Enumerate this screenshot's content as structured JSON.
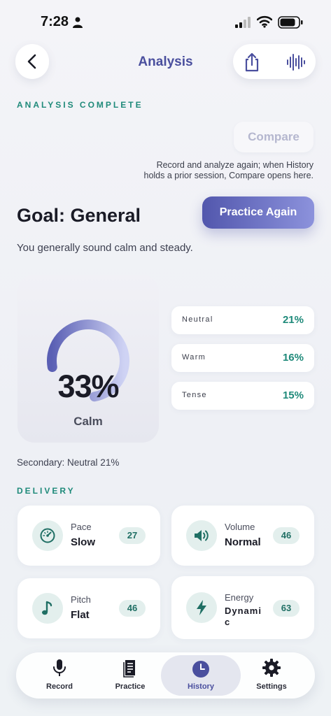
{
  "status": {
    "time": "7:28"
  },
  "header": {
    "title": "Analysis"
  },
  "analysis": {
    "status_label": "ANALYSIS COMPLETE",
    "compare_label": "Compare",
    "compare_hint": "Record and analyze again; when History holds a prior session, Compare opens here.",
    "goal_title": "Goal: General",
    "practice_label": "Practice Again",
    "summary": "You generally sound calm and steady."
  },
  "emotion": {
    "primary_percent": "33%",
    "primary_fraction": 0.33,
    "primary_label": "Calm",
    "others": [
      {
        "name": "Neutral",
        "value": "21%"
      },
      {
        "name": "Warm",
        "value": "16%"
      },
      {
        "name": "Tense",
        "value": "15%"
      }
    ],
    "secondary": "Secondary: Neutral 21%"
  },
  "delivery": {
    "section_label": "DELIVERY",
    "metrics": [
      {
        "name": "Pace",
        "value": "Slow",
        "score": "27",
        "icon": "speedometer-icon"
      },
      {
        "name": "Volume",
        "value": "Normal",
        "score": "46",
        "icon": "speaker-icon"
      },
      {
        "name": "Pitch",
        "value": "Flat",
        "score": "46",
        "icon": "music-note-icon"
      },
      {
        "name": "Energy",
        "value": "Dynamic",
        "score": "63",
        "icon": "lightning-icon"
      }
    ]
  },
  "tabs": [
    {
      "label": "Record",
      "icon": "microphone-icon"
    },
    {
      "label": "Practice",
      "icon": "document-icon"
    },
    {
      "label": "History",
      "icon": "clock-icon"
    },
    {
      "label": "Settings",
      "icon": "gear-icon"
    }
  ],
  "colors": {
    "accent": "#4a4f9e",
    "teal": "#1f8a7a",
    "gauge_start": "#5a5fb4",
    "gauge_end": "#cfd3f4"
  }
}
